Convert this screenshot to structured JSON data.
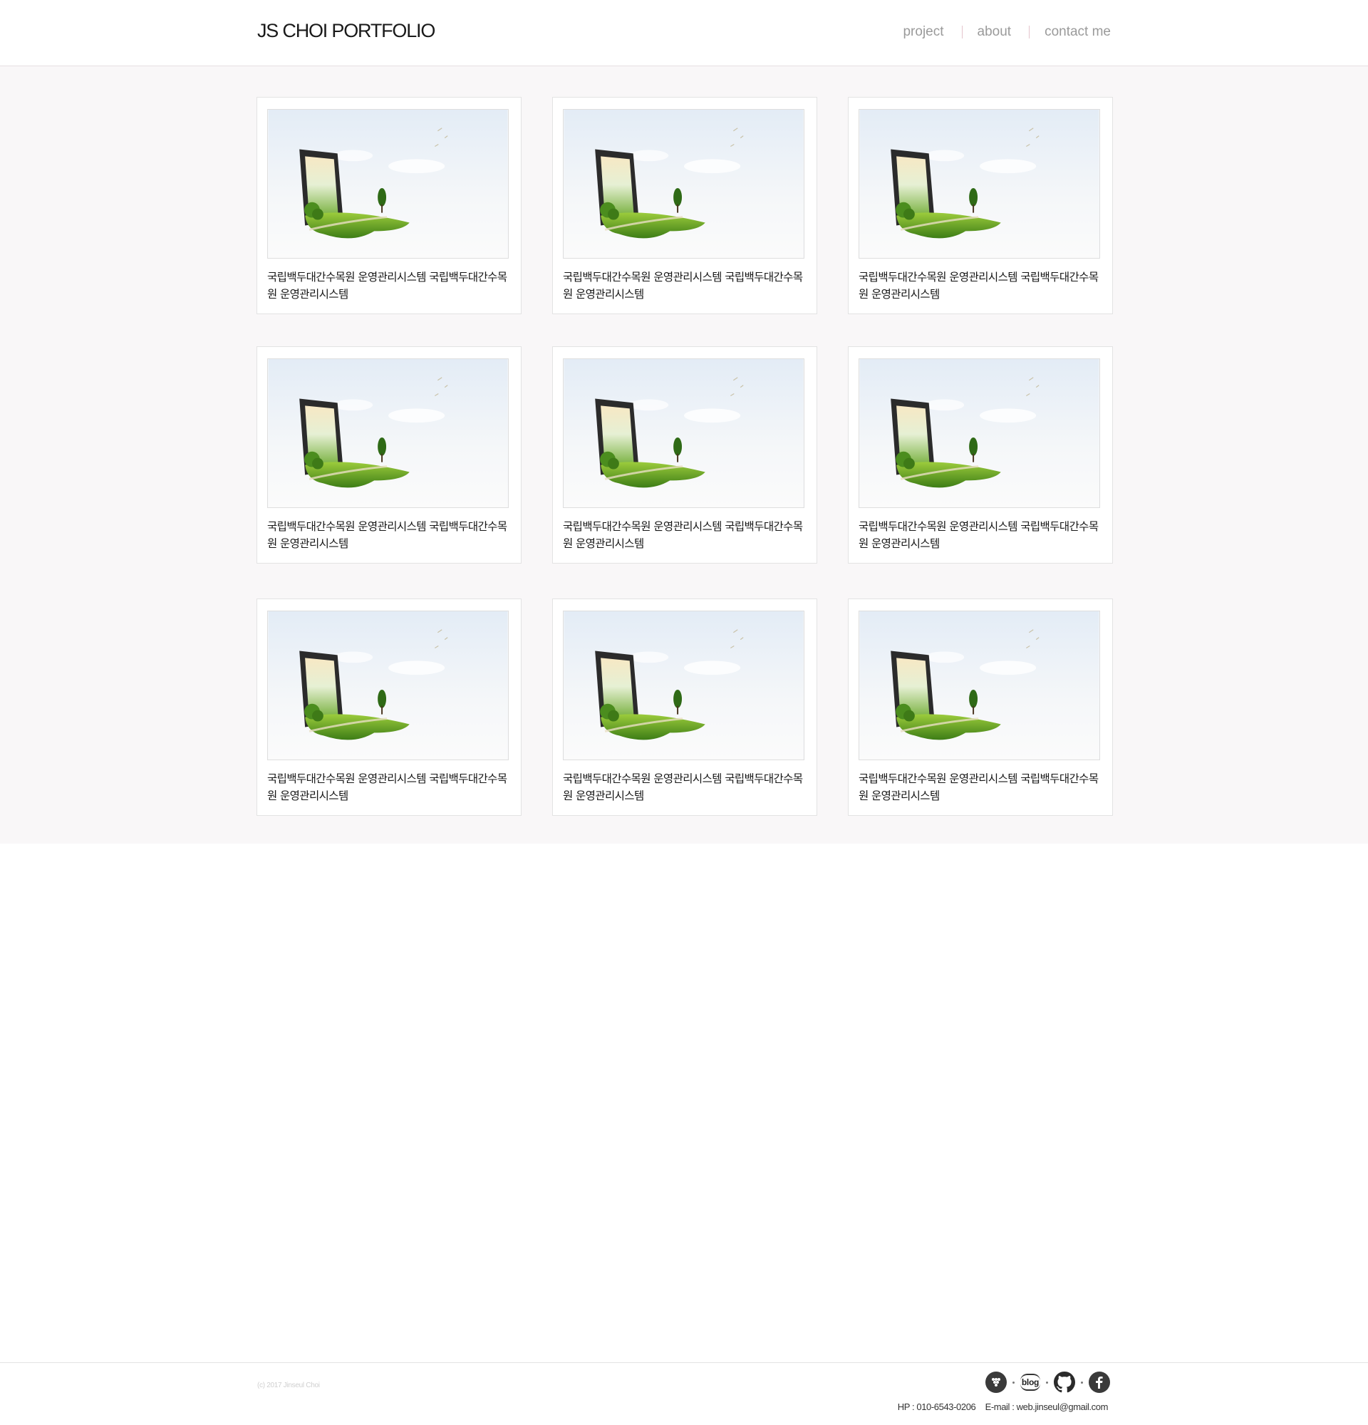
{
  "header": {
    "logo": "JS CHOI PORTFOLIO",
    "nav": [
      "project",
      "about",
      "contact me"
    ]
  },
  "projects": [
    {
      "title": "국립백두대간수목원 운영관리시스템 국립백두대간수목원 운영관리시스템"
    },
    {
      "title": "국립백두대간수목원 운영관리시스템 국립백두대간수목원 운영관리시스템"
    },
    {
      "title": "국립백두대간수목원 운영관리시스템 국립백두대간수목원 운영관리시스템"
    },
    {
      "title": "국립백두대간수목원 운영관리시스템 국립백두대간수목원 운영관리시스템"
    },
    {
      "title": "국립백두대간수목원 운영관리시스템 국립백두대간수목원 운영관리시스템"
    },
    {
      "title": "국립백두대간수목원 운영관리시스템 국립백두대간수목원 운영관리시스템"
    },
    {
      "title": "국립백두대간수목원 운영관리시스템 국립백두대간수목원 운영관리시스템"
    },
    {
      "title": "국립백두대간수목원 운영관리시스템 국립백두대간수목원 운영관리시스템"
    },
    {
      "title": "국립백두대간수목원 운영관리시스템 국립백두대간수목원 운영관리시스템"
    }
  ],
  "footer": {
    "copyright": "(c) 2017 Jinseul Choi",
    "blog_label": "blog",
    "social_icons": [
      "kakao-icon",
      "blog-icon",
      "github-icon",
      "facebook-icon"
    ],
    "phone": "HP : 010-6543-0206",
    "email": "E-mail : web.jinseul@gmail.com"
  },
  "colors": {
    "grid_background": "#f9f7f8",
    "nav_text": "#9a9a9a",
    "nav_separator": "#e4c4cc",
    "icon_dark": "#3a3a3a"
  }
}
